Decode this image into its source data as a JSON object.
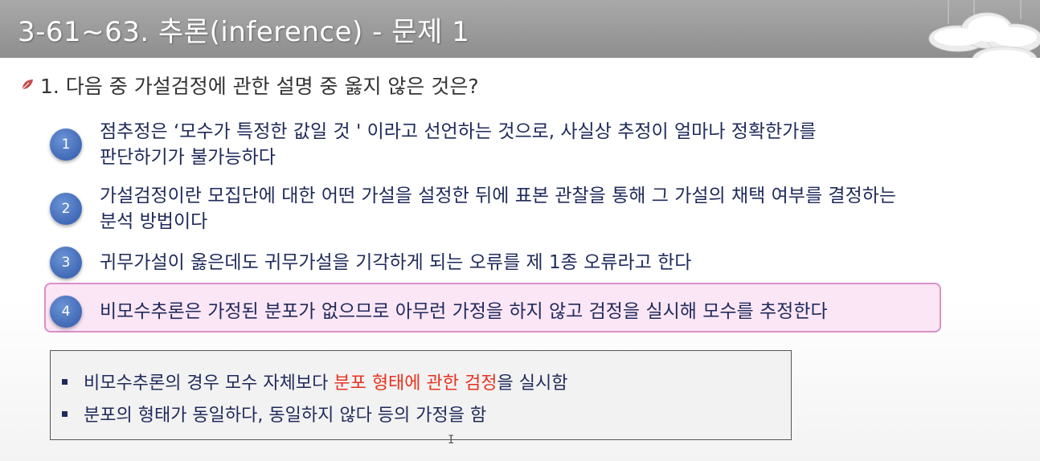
{
  "title": "3-61~63. 추론(inference) - 문제 1",
  "question": "1. 다음 중 가설검정에 관한 설명 중 옳지 않은 것은?",
  "options": [
    {
      "num": "1",
      "lines": [
        "점추정은 ‘모수가 특정한 값일 것 ' 이라고 선언하는 것으로, 사실상 추정이 얼마나 정확한가를",
        "판단하기가 불가능하다"
      ]
    },
    {
      "num": "2",
      "lines": [
        "가설검정이란 모집단에 대한 어떤 가설을 설정한 뒤에 표본 관찰을 통해 그 가설의 채택 여부를 결정하는",
        "분석 방법이다"
      ]
    },
    {
      "num": "3",
      "lines": [
        "귀무가설이 옳은데도 귀무가설을 기각하게 되는 오류를 제 1종 오류라고 한다"
      ]
    },
    {
      "num": "4",
      "lines": [
        "비모수추론은 가정된 분포가 없으므로 아무런 가정을 하지 않고 검정을 실시해 모수를 추정한다"
      ]
    }
  ],
  "notes": [
    {
      "before": "비모수추론의 경우 모수 자체보다 ",
      "highlight": "분포 형태에 관한 검정",
      "after": "을 실시함"
    },
    {
      "before": "분포의 형태가 동일하다, 동일하지 않다 등의 가정을 함"
    }
  ],
  "colors": {
    "title_bar": "#9a9a9a",
    "option_text": "#1f2a5a",
    "number_circle": "#3a63b8",
    "highlight_fill": "#fbe6f6",
    "highlight_border": "#d98fc8",
    "note_emphasis": "#e8321f"
  },
  "icons": {
    "question_marker": "leaf-icon",
    "decoration": "cloud-icon",
    "pointer": "text-cursor-icon"
  }
}
